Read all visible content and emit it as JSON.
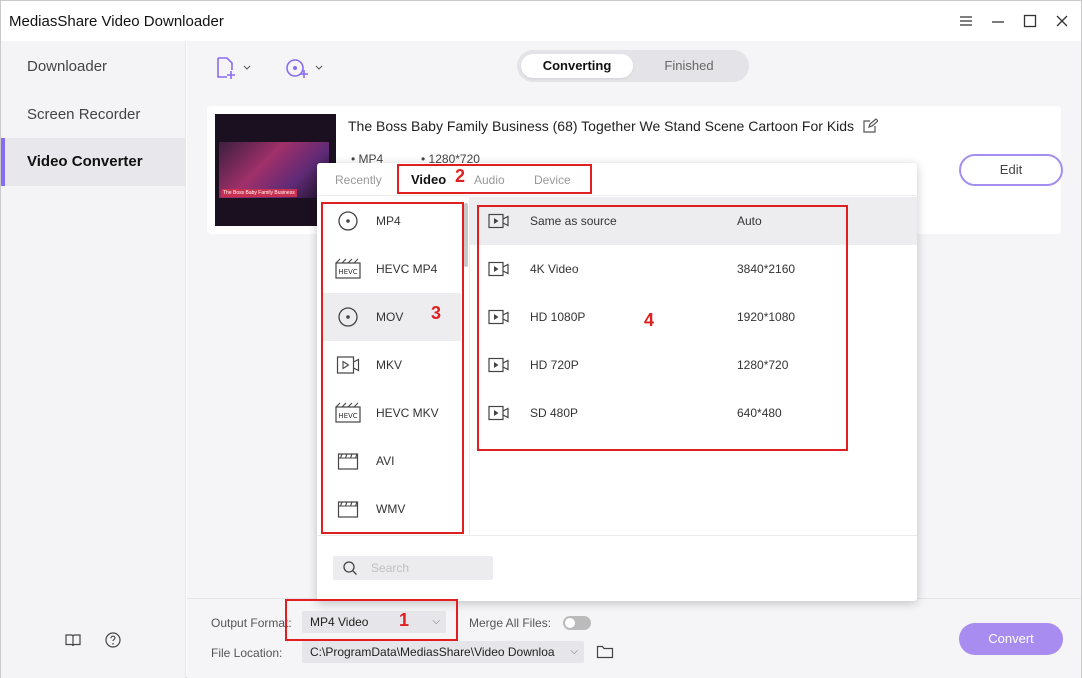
{
  "app": {
    "title": "MediasShare Video Downloader"
  },
  "sidebar": {
    "items": [
      {
        "label": "Downloader"
      },
      {
        "label": "Screen Recorder"
      },
      {
        "label": "Video Converter"
      }
    ]
  },
  "toolbar": {
    "tabs": [
      {
        "label": "Converting"
      },
      {
        "label": "Finished"
      }
    ]
  },
  "video": {
    "title": "The Boss Baby Family Business (68)  Together We Stand Scene  Cartoon For Kids",
    "format": "MP4",
    "resolution": "1280*720",
    "thumbnail_caption": "The Boss Baby Family Business",
    "edit_label": "Edit"
  },
  "format_panel": {
    "tabs": [
      {
        "label": "Recently"
      },
      {
        "label": "Video"
      },
      {
        "label": "Audio"
      },
      {
        "label": "Device"
      }
    ],
    "formats": [
      {
        "label": "MP4",
        "icon": "disc-icon"
      },
      {
        "label": "HEVC MP4",
        "icon": "hevc-icon"
      },
      {
        "label": "MOV",
        "icon": "disc-icon"
      },
      {
        "label": "MKV",
        "icon": "video-file-icon"
      },
      {
        "label": "HEVC MKV",
        "icon": "hevc-icon"
      },
      {
        "label": "AVI",
        "icon": "clapper-icon"
      },
      {
        "label": "WMV",
        "icon": "clapper-icon"
      }
    ],
    "resolutions": [
      {
        "name": "Same as source",
        "value": "Auto"
      },
      {
        "name": "4K Video",
        "value": "3840*2160"
      },
      {
        "name": "HD 1080P",
        "value": "1920*1080"
      },
      {
        "name": "HD 720P",
        "value": "1280*720"
      },
      {
        "name": "SD 480P",
        "value": "640*480"
      }
    ],
    "search_placeholder": "Search"
  },
  "bottom": {
    "output_format_label": "Output Format:",
    "output_format_value": "MP4 Video",
    "merge_label": "Merge All Files:",
    "file_location_label": "File Location:",
    "file_location_value": "C:\\ProgramData\\MediasShare\\Video Downloa",
    "convert_label": "Convert"
  },
  "annotations": {
    "n1": "1",
    "n2": "2",
    "n3": "3",
    "n4": "4"
  },
  "colors": {
    "accent": "#8a6cf0",
    "annotation": "#e02020",
    "convert_button": "#a88cf0"
  }
}
